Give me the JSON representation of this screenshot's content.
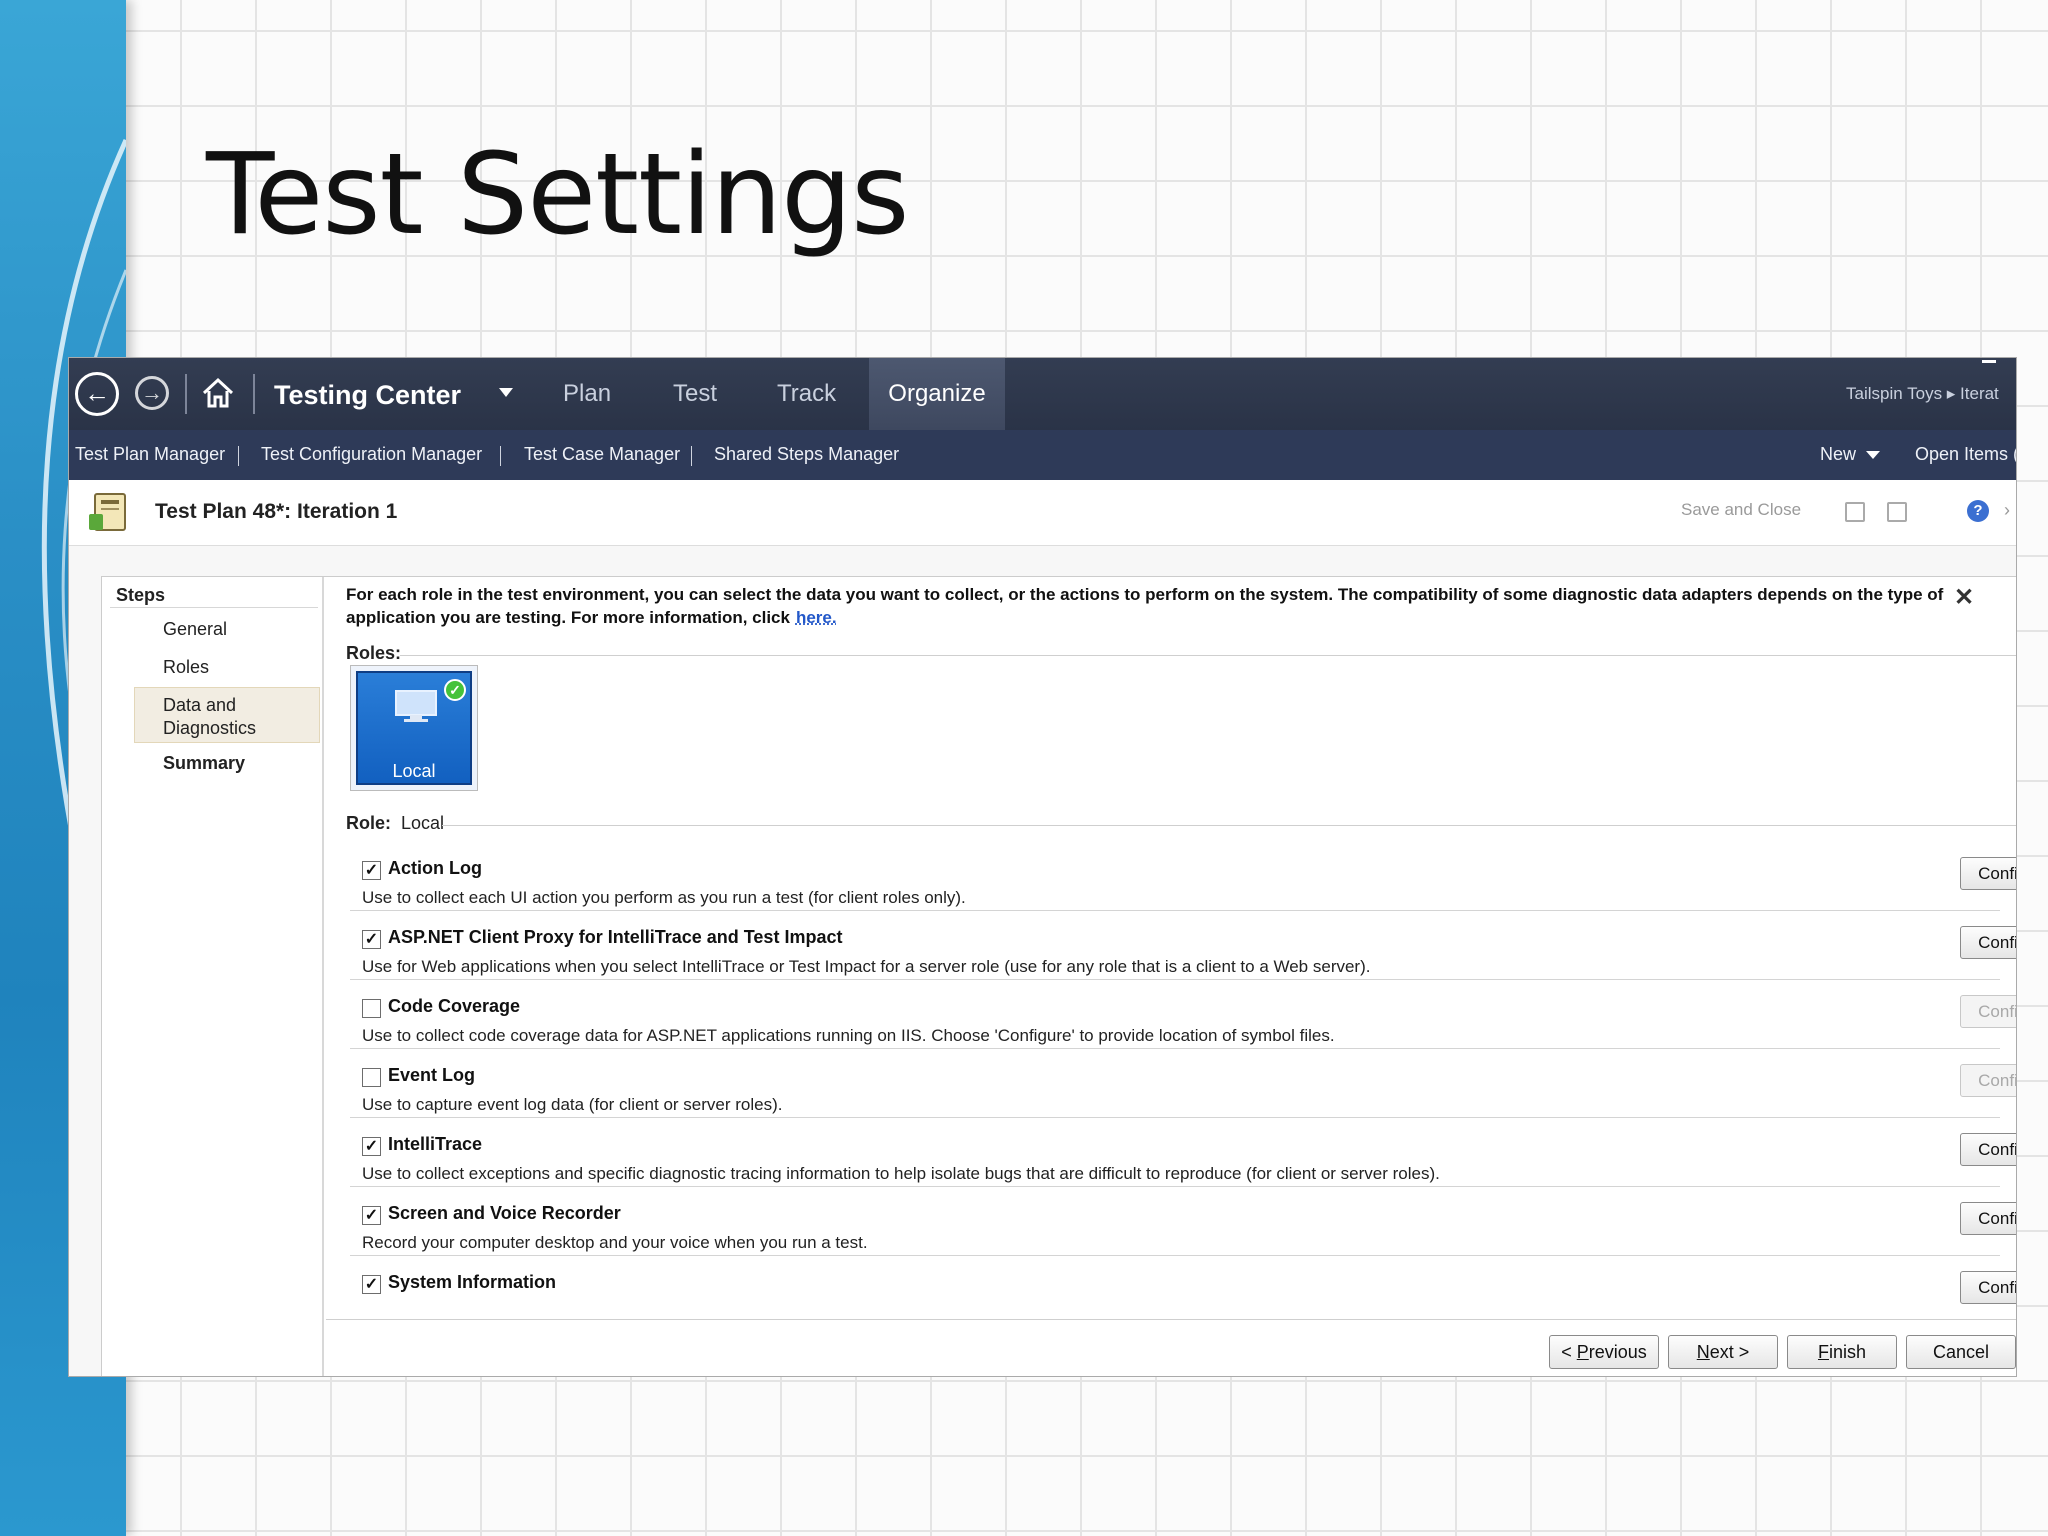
{
  "slide": {
    "title": "Test Settings"
  },
  "app": {
    "nav": {
      "title": "Testing Center",
      "tabs": [
        "Plan",
        "Test",
        "Track",
        "Organize"
      ],
      "active_tab": "Organize",
      "breadcrumb": "Tailspin Toys ▸ Iterat"
    },
    "subnav": {
      "items": [
        "Test Plan Manager",
        "Test Configuration Manager",
        "Test Case Manager",
        "Shared Steps Manager"
      ],
      "new_label": "New",
      "open_items_label": "Open Items ("
    },
    "plan": {
      "title": "Test Plan 48*: Iteration 1",
      "save_close_label": "Save and Close",
      "help_glyph": "?",
      "close_glyph": "›"
    },
    "wizard": {
      "steps_header": "Steps",
      "steps": [
        "General",
        "Roles",
        "Data and Diagnostics",
        "Summary"
      ],
      "active_step": "Data and Diagnostics",
      "description": "For each role in the test environment, you can select the data you want to collect, or the actions to perform on the system. The compatibility of some diagnostic data adapters depends on the type of application you are testing. For more information, click",
      "link_text": "here.",
      "close_glyph": "✕",
      "roles_label": "Roles:",
      "role_tile_label": "Local",
      "role_prefix": "Role:",
      "role_value": "Local",
      "adapters": [
        {
          "name": "Action Log",
          "checked": true,
          "desc": "Use to collect each UI action you perform as you run a test (for client roles only).",
          "button": "Configure",
          "enabled": true
        },
        {
          "name": "ASP.NET Client Proxy for IntelliTrace and Test Impact",
          "checked": true,
          "desc": "Use for Web applications when you select IntelliTrace or Test Impact for a server role (use for any role that is a client to a Web server).",
          "button": "Configure",
          "enabled": true
        },
        {
          "name": "Code Coverage",
          "checked": false,
          "desc": "Use to collect code coverage data for ASP.NET applications running on IIS. Choose 'Configure' to provide location of symbol files.",
          "button": "Configure",
          "enabled": false
        },
        {
          "name": "Event Log",
          "checked": false,
          "desc": "Use to capture event log data (for client or server roles).",
          "button": "Configure",
          "enabled": false
        },
        {
          "name": "IntelliTrace",
          "checked": true,
          "desc": "Use to collect exceptions and specific diagnostic tracing information to help isolate bugs that are difficult to reproduce (for client or server roles).",
          "button": "Configure",
          "enabled": true
        },
        {
          "name": "Screen and Voice Recorder",
          "checked": true,
          "desc": "Record your computer desktop and your voice when you run a test.",
          "button": "Configure",
          "enabled": true
        },
        {
          "name": "System Information",
          "checked": true,
          "desc": "",
          "button": "Configure",
          "enabled": true
        }
      ],
      "buttons": {
        "previous": {
          "before": "< ",
          "key": "P",
          "after": "revious"
        },
        "next": {
          "before": "",
          "key": "N",
          "after": "ext >"
        },
        "finish": {
          "before": "",
          "key": "F",
          "after": "inish"
        },
        "cancel": {
          "before": "",
          "key": "",
          "after": "Cancel"
        }
      }
    }
  },
  "colors": {
    "topbar": "#2a3347",
    "subbar": "#2e3a58",
    "active_tab_underline": "#f0a830",
    "role_tile": "#1a6fd0",
    "link": "#2358c9"
  }
}
